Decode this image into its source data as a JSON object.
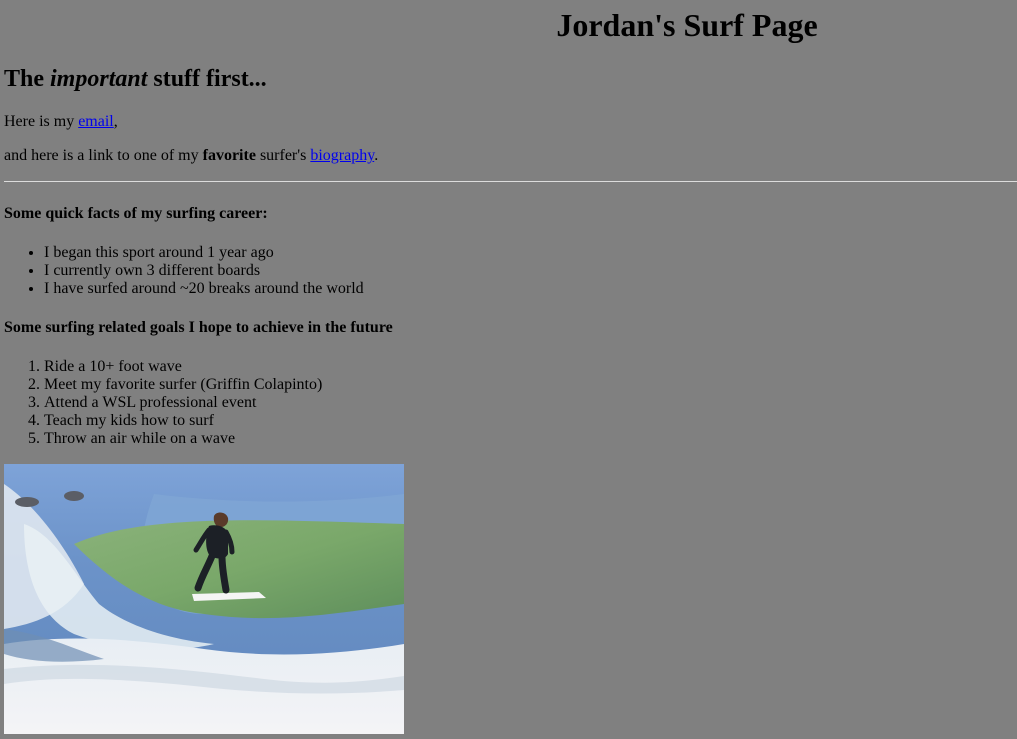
{
  "page": {
    "title": "Jordan's Surf Page"
  },
  "intro": {
    "heading_pre": "The ",
    "heading_em": "important",
    "heading_post": " stuff first...",
    "email_pre": "Here is my ",
    "email_link": "email",
    "email_post": ",",
    "bio_pre": "and here is a link to one of my ",
    "bio_bold": "favorite",
    "bio_mid": " surfer's ",
    "bio_link": "biography",
    "bio_post": "."
  },
  "facts": {
    "heading": "Some quick facts of my surfing career:",
    "items": [
      "I began this sport around 1 year ago",
      "I currently own 3 different boards",
      "I have surfed around ~20 breaks around the world"
    ]
  },
  "goals": {
    "heading": "Some surfing related goals I hope to achieve in the future",
    "items": [
      "Ride a 10+ foot wave",
      "Meet my favorite surfer (Griffin Colapinto)",
      "Attend a WSL professional event",
      "Teach my kids how to surf",
      "Throw an air while on a wave"
    ]
  },
  "colors": {
    "background": "#808080",
    "link": "#0000ee"
  },
  "image": {
    "icon": "surfer-photo"
  }
}
